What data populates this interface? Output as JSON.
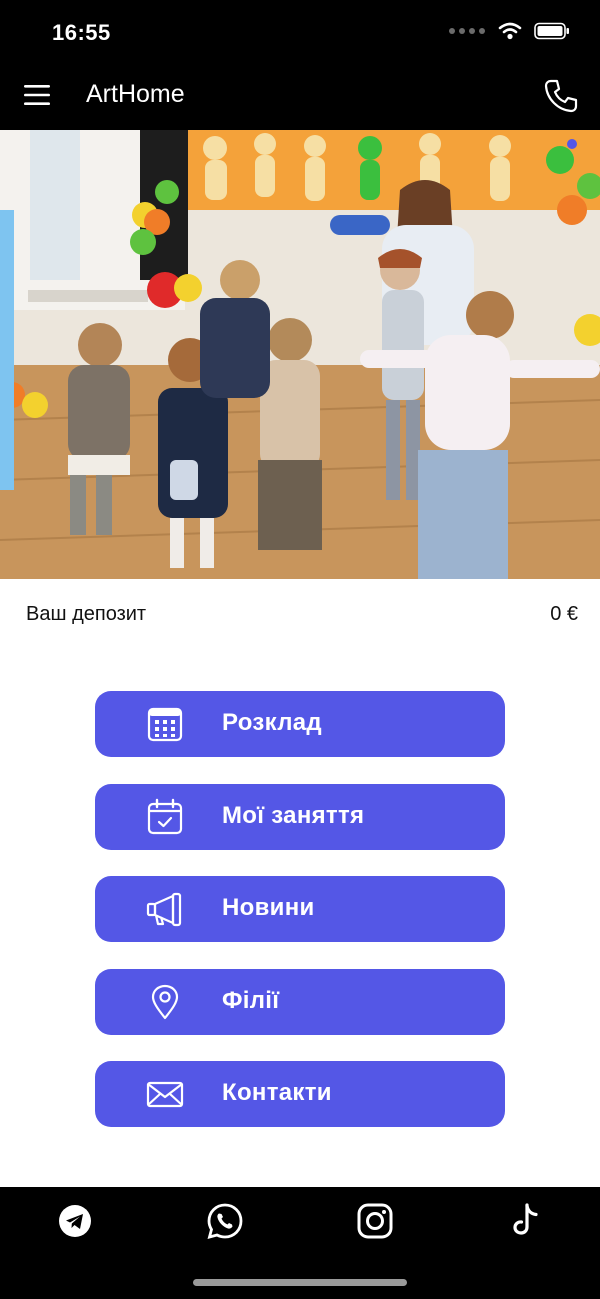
{
  "status_bar": {
    "time": "16:55"
  },
  "header": {
    "title": "ArtHome"
  },
  "deposit": {
    "label": "Ваш депозит",
    "value": "0 €"
  },
  "menu": {
    "items": [
      {
        "label": "Розклад",
        "icon": "calendar-grid-icon"
      },
      {
        "label": "Мої заняття",
        "icon": "calendar-check-icon"
      },
      {
        "label": "Новини",
        "icon": "megaphone-icon"
      },
      {
        "label": "Філії",
        "icon": "location-pin-icon"
      },
      {
        "label": "Контакти",
        "icon": "envelope-icon"
      }
    ]
  },
  "social": [
    "telegram-icon",
    "whatsapp-icon",
    "instagram-icon",
    "tiktok-icon"
  ],
  "colors": {
    "accent": "#5457e6",
    "bars": "#000000",
    "background": "#ffffff"
  }
}
